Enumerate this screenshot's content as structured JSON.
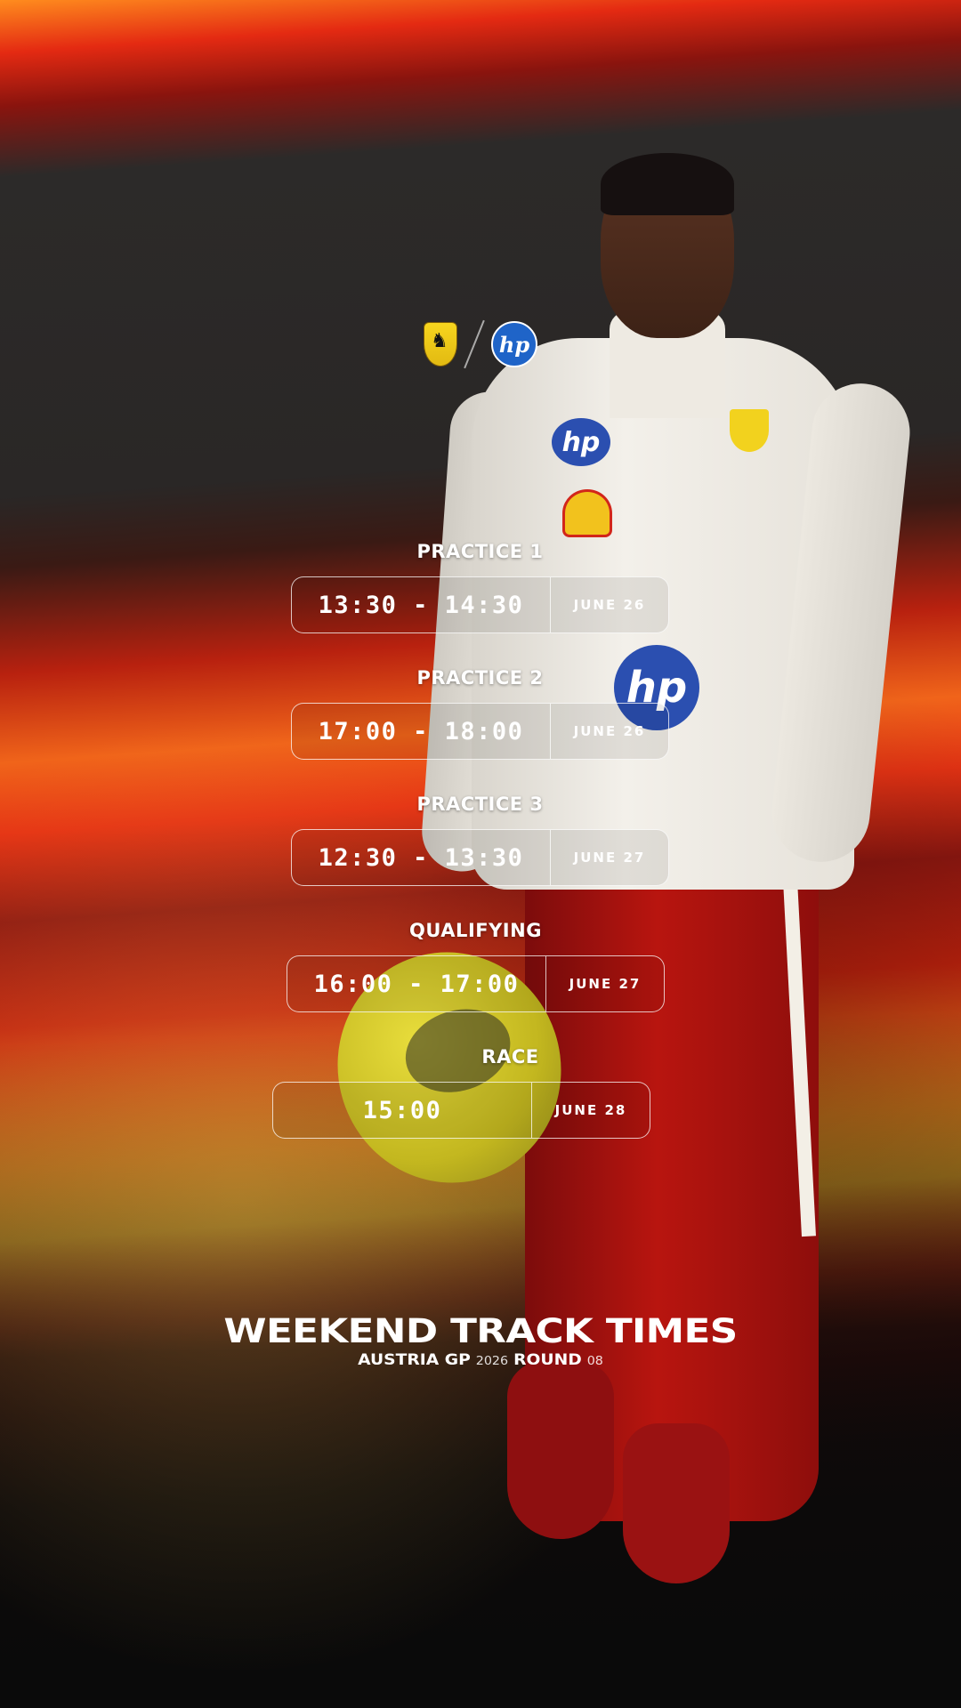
{
  "logos": {
    "left": "ferrari-shield-icon",
    "right": "hp-logo-icon",
    "hp_text": "hp"
  },
  "sessions": [
    {
      "title": "PRACTICE 1",
      "time": "13:30 - 14:30",
      "date": "JUNE 26"
    },
    {
      "title": "PRACTICE 2",
      "time": "17:00 - 18:00",
      "date": "JUNE 26"
    },
    {
      "title": "PRACTICE 3",
      "time": "12:30 - 13:30",
      "date": "JUNE 27"
    },
    {
      "title": "QUALIFYING",
      "time": "16:00 - 17:00",
      "date": "JUNE 27"
    },
    {
      "title": "RACE",
      "time": "15:00",
      "date": "JUNE 28"
    }
  ],
  "footer": {
    "title": "WEEKEND TRACK TIMES",
    "event": "AUSTRIA GP",
    "year": "2026",
    "round_label": "ROUND",
    "round_number": "08"
  },
  "colors": {
    "accent_red": "#c8160f",
    "accent_orange": "#f28a1f",
    "text": "#ffffff"
  }
}
